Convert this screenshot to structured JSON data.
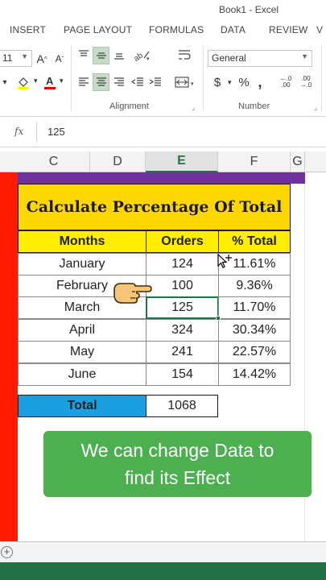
{
  "window": {
    "title": "Book1 - Excel"
  },
  "ribbon_tabs": [
    "INSERT",
    "PAGE LAYOUT",
    "FORMULAS",
    "DATA",
    "REVIEW",
    "V"
  ],
  "ribbon": {
    "font_size": "11",
    "grow_font": "A",
    "shrink_font": "A",
    "number_format": "General",
    "currency_symbol": "$",
    "percent_symbol": "%",
    "comma_symbol": ",",
    "increase_decimal": "←.0 .00",
    "decrease_decimal": ".00 →.0",
    "groups": {
      "alignment": "Alignment",
      "number": "Number"
    }
  },
  "formula_bar": {
    "fx": "fx",
    "value": "125"
  },
  "columns": [
    "C",
    "D",
    "E",
    "F",
    "G"
  ],
  "table": {
    "title": "Calculate Percentage Of Total",
    "headers": [
      "Months",
      "Orders",
      "% Total"
    ],
    "rows": [
      {
        "month": "January",
        "orders": "124",
        "pct": "11.61%"
      },
      {
        "month": "February",
        "orders": "100",
        "pct": "9.36%"
      },
      {
        "month": "March",
        "orders": "125",
        "pct": "11.70%"
      },
      {
        "month": "April",
        "orders": "324",
        "pct": "30.34%"
      },
      {
        "month": "May",
        "orders": "241",
        "pct": "22.57%"
      },
      {
        "month": "June",
        "orders": "154",
        "pct": "14.42%"
      }
    ],
    "total_label": "Total",
    "total_value": "1068"
  },
  "caption": {
    "line1": "We can change Data to",
    "line2": "find its Effect"
  },
  "sheet_bar": {
    "add_sheet": "+"
  },
  "colors": {
    "excel_green": "#217346",
    "title_yellow": "#ffd700",
    "header_yellow": "#ffee00",
    "total_blue": "#1aa0e0",
    "banner_green": "#4caf50",
    "red_bar": "#ff1a00",
    "purple_bar": "#7030a0"
  }
}
